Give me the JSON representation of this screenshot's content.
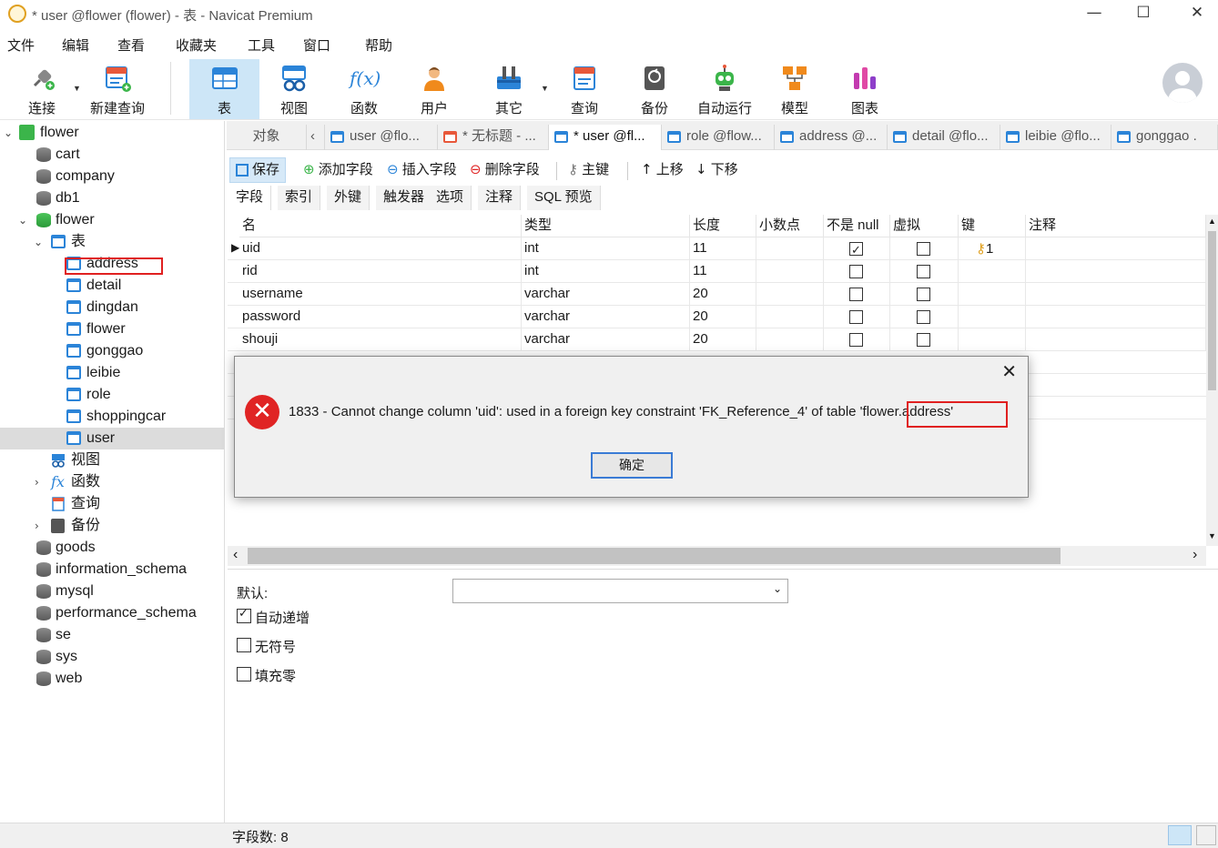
{
  "window": {
    "title": "* user @flower (flower) - 表 - Navicat Premium",
    "minimize": "—",
    "maximize": "☐",
    "close": "✕"
  },
  "menu": [
    "文件",
    "编辑",
    "查看",
    "收藏夹",
    "工具",
    "窗口",
    "帮助"
  ],
  "toolbar": {
    "connect": "连接",
    "new_query": "新建查询",
    "table": "表",
    "view": "视图",
    "function": "函数",
    "user": "用户",
    "other": "其它",
    "query": "查询",
    "backup": "备份",
    "automation": "自动运行",
    "model": "模型",
    "chart": "图表",
    "fx": "f(x)"
  },
  "tree": {
    "root": "flower",
    "items": [
      "cart",
      "company",
      "db1"
    ],
    "db_open": "flower",
    "tables_node": "表",
    "tables": [
      "address",
      "detail",
      "dingdan",
      "flower",
      "gonggao",
      "leibie",
      "role",
      "shoppingcar",
      "user"
    ],
    "views": "视图",
    "functions": "函数",
    "queries": "查询",
    "backups": "备份",
    "fx": "fx",
    "other_dbs": [
      "goods",
      "information_schema",
      "mysql",
      "performance_schema",
      "se",
      "sys",
      "web"
    ]
  },
  "tabs": {
    "objects": "对象",
    "list": [
      "user @flo...",
      "* 无标题 - ...",
      "* user @fl...",
      "role @flow...",
      "address @...",
      "detail @flo...",
      "leibie @flo...",
      "gonggao ."
    ]
  },
  "actions": {
    "save": "保存",
    "add_field": "添加字段",
    "insert_field": "插入字段",
    "delete_field": "删除字段",
    "primary_key": "主键",
    "move_up": "上移",
    "move_down": "下移"
  },
  "field_tabs": [
    "字段",
    "索引",
    "外键",
    "触发器",
    "选项",
    "注释",
    "SQL 预览"
  ],
  "grid": {
    "headers": [
      "名",
      "类型",
      "长度",
      "小数点",
      "不是 null",
      "虚拟",
      "键",
      "注释"
    ],
    "rows": [
      {
        "name": "uid",
        "type": "int",
        "length": "11",
        "decimal": "",
        "not_null": true,
        "virtual": false,
        "key": "1"
      },
      {
        "name": "rid",
        "type": "int",
        "length": "11",
        "decimal": "",
        "not_null": false,
        "virtual": false,
        "key": ""
      },
      {
        "name": "username",
        "type": "varchar",
        "length": "20",
        "decimal": "",
        "not_null": false,
        "virtual": false,
        "key": ""
      },
      {
        "name": "password",
        "type": "varchar",
        "length": "20",
        "decimal": "",
        "not_null": false,
        "virtual": false,
        "key": ""
      },
      {
        "name": "shouji",
        "type": "varchar",
        "length": "20",
        "decimal": "",
        "not_null": false,
        "virtual": false,
        "key": ""
      }
    ]
  },
  "props": {
    "default_label": "默认:",
    "default_value": "",
    "auto_increment": "自动递增",
    "auto_increment_checked": true,
    "unsigned": "无符号",
    "unsigned_checked": false,
    "zerofill": "填充零",
    "zerofill_checked": false
  },
  "status": {
    "field_count": "字段数: 8"
  },
  "dialog": {
    "message_prefix": "1833 - Cannot change column 'uid': used in a foreign key constraint 'FK_Reference_4' of table '",
    "message_highlight": "flower.address",
    "message_suffix": "'",
    "ok": "确定",
    "close": "✕",
    "error_icon": "✕"
  },
  "colors": {
    "accent": "#2b84d8",
    "selection": "#cde6f7",
    "error": "#e02424",
    "highlight_box": "#e02020"
  }
}
